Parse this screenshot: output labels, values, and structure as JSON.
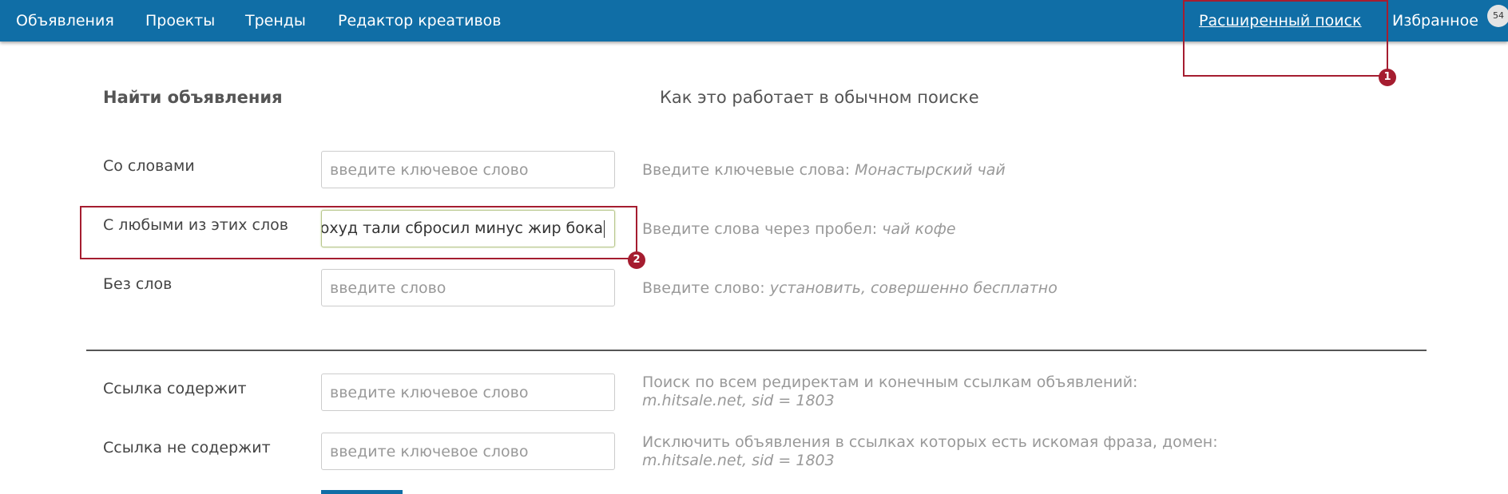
{
  "nav": {
    "items": [
      "Объявления",
      "Проекты",
      "Тренды",
      "Редактор креативов"
    ],
    "advanced_search": "Расширенный поиск",
    "favorites": "Избранное",
    "favorites_count": "54"
  },
  "annotations": [
    "1",
    "2"
  ],
  "page": {
    "title": "Найти объявления",
    "side_title": "Как это работает в обычном поиске"
  },
  "form": {
    "with_words": {
      "label": "Со словами",
      "placeholder": "введите ключевое слово",
      "hint_text": "Введите ключевые слова:",
      "hint_example": "Монастырский чай"
    },
    "any_words": {
      "label": "С любыми из этих слов",
      "value": "охуд тали сбросил минус жир бока",
      "hint_text": "Введите слова через пробел:",
      "hint_example": "чай кофе"
    },
    "without_words": {
      "label": "Без слов",
      "placeholder": "введите слово",
      "hint_text": "Введите слово:",
      "hint_example": "установить, совершенно бесплатно"
    },
    "link_contains": {
      "label": "Ссылка содержит",
      "placeholder": "введите ключевое слово",
      "hint_line1": "Поиск по всем редиректам и конечным ссылкам объявлений:",
      "hint_line2": "m.hitsale.net, sid = 1803"
    },
    "link_not_contains": {
      "label": "Ссылка не содержит",
      "placeholder": "введите ключевое слово",
      "hint_line1": "Исключить объявления в ссылках которых есть искомая фраза, домен:",
      "hint_line2": "m.hitsale.net, sid = 1803"
    }
  },
  "colors": {
    "topbar": "#106ea6",
    "annotation": "#a51d30",
    "active_input_border": "#b8c78d"
  }
}
